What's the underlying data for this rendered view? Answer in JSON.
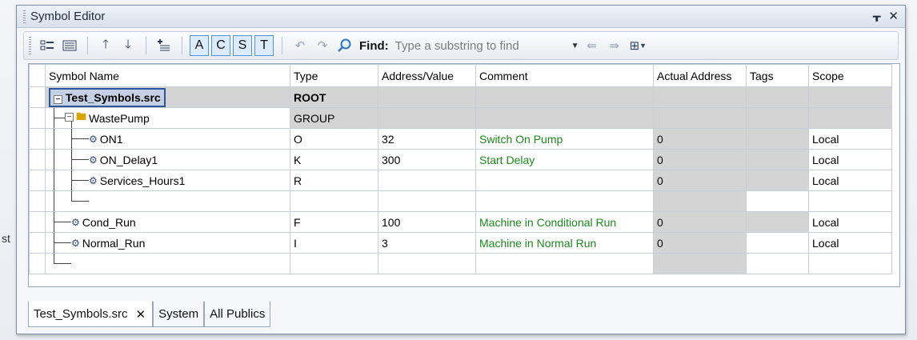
{
  "panel": {
    "title": "Symbol Editor",
    "pin_icon": "pin-icon",
    "close_icon": "close-icon"
  },
  "toolbar": {
    "toggles": [
      "A",
      "C",
      "S",
      "T"
    ],
    "find_label": "Find:",
    "find_placeholder": "Type a substring to find"
  },
  "grid": {
    "columns": [
      "Symbol Name",
      "Type",
      "Address/Value",
      "Comment",
      "Actual Address",
      "Tags",
      "Scope"
    ],
    "rows": [
      {
        "name": "Test_Symbols.src",
        "type": "ROOT",
        "address": "",
        "comment": "",
        "actual": "",
        "tags": "",
        "scope": ""
      },
      {
        "name": "WastePump",
        "type": "GROUP",
        "address": "",
        "comment": "",
        "actual": "",
        "tags": "",
        "scope": ""
      },
      {
        "name": "ON1",
        "type": "O",
        "address": "32",
        "comment": "Switch On Pump",
        "actual": "0",
        "tags": "",
        "scope": "Local"
      },
      {
        "name": "ON_Delay1",
        "type": "K",
        "address": "300",
        "comment": "Start Delay",
        "actual": "0",
        "tags": "",
        "scope": "Local"
      },
      {
        "name": "Services_Hours1",
        "type": "R",
        "address": "",
        "comment": "",
        "actual": "0",
        "tags": "",
        "scope": "Local"
      },
      {
        "name": "",
        "type": "",
        "address": "",
        "comment": "",
        "actual": "",
        "tags": "",
        "scope": ""
      },
      {
        "name": "Cond_Run",
        "type": "F",
        "address": "100",
        "comment": "Machine in Conditional Run",
        "actual": "0",
        "tags": "",
        "scope": "Local"
      },
      {
        "name": "Normal_Run",
        "type": "I",
        "address": "3",
        "comment": "Machine in Normal Run",
        "actual": "0",
        "tags": "",
        "scope": "Local"
      },
      {
        "name": "",
        "type": "",
        "address": "",
        "comment": "",
        "actual": "",
        "tags": "",
        "scope": ""
      }
    ]
  },
  "tabs": [
    {
      "label": "Test_Symbols.src",
      "close": "✕"
    },
    {
      "label": "System"
    },
    {
      "label": "All Publics"
    }
  ],
  "colors": {
    "comment": "#1a8a1a",
    "accent": "#4f93d8",
    "gray_cell": "#d4d4d4"
  }
}
